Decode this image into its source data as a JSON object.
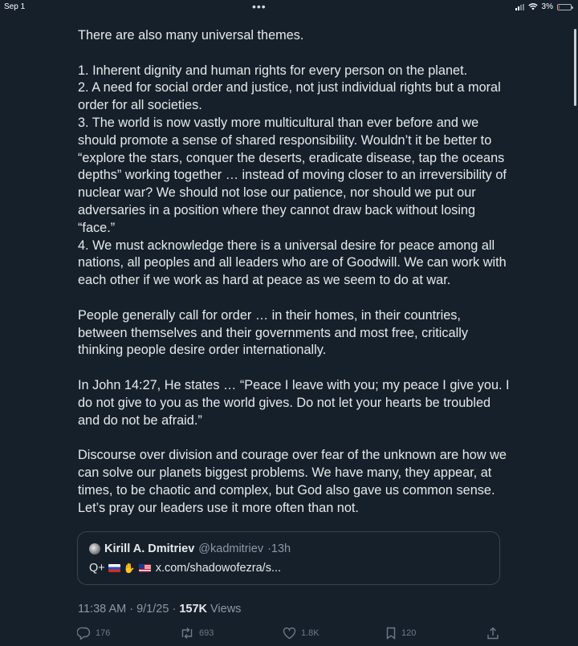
{
  "status_bar": {
    "date": "Sep 1",
    "dots": "•••",
    "battery": "3%"
  },
  "tweet": {
    "paragraphs": [
      "There are also many universal themes.",
      "",
      "1. Inherent dignity and human rights for every person on the planet.",
      "2. A need for social order and justice, not just individual rights but a moral order for all societies.",
      "3. The world is now vastly more multicultural than ever before and we should promote a sense of shared responsibility. Wouldn’t it be better to “explore the stars, conquer the deserts, eradicate disease, tap the oceans depths” working together … instead of moving closer to an irreversibility of nuclear war? We should not lose our patience, nor should we put our adversaries in a position where they cannot draw back without losing “face.”",
      "4. We must acknowledge there is a universal desire for peace among all nations, all peoples and all leaders who are of Goodwill. We can work with each other if we work as hard at peace as we seem to do at war.",
      "",
      "People generally call for order … in their homes, in their countries, between themselves and their governments and most free, critically thinking people desire order internationally.",
      "",
      "In John 14:27, He states … “Peace I leave with you; my peace I give you. I do not give to you as the world gives. Do not let your hearts be troubled and do not be afraid.”",
      "",
      "Discourse over division and courage over fear of the unknown are how we can solve our planets biggest problems. We have many, they appear, at times, to be chaotic and complex, but God also gave us common sense. Let’s pray our leaders use it more often than not."
    ]
  },
  "quote": {
    "name": "Kirill A. Dmitriev",
    "handle": "@kadmitriev",
    "time": "·13h",
    "prefix": "Q+",
    "link": "x.com/shadowofezra/s..."
  },
  "meta": {
    "time": "11:38 AM",
    "sep1": " · ",
    "date": "9/1/25",
    "sep2": " · ",
    "views_count": "157K",
    "views_label": " Views"
  },
  "actions": {
    "replies": "176",
    "reposts": "693",
    "likes": "1.8K",
    "bookmarks": "120"
  },
  "colors": {
    "background": "#15202b",
    "text": "#e7e9ea",
    "secondary": "#8b98a5",
    "border": "#38444d"
  },
  "icons": [
    "signal-icon",
    "wifi-icon",
    "battery-icon",
    "avatar",
    "flag-russia-icon",
    "handshake-icon",
    "flag-usa-icon",
    "reply-icon",
    "repost-icon",
    "like-icon",
    "bookmark-icon",
    "share-icon"
  ]
}
